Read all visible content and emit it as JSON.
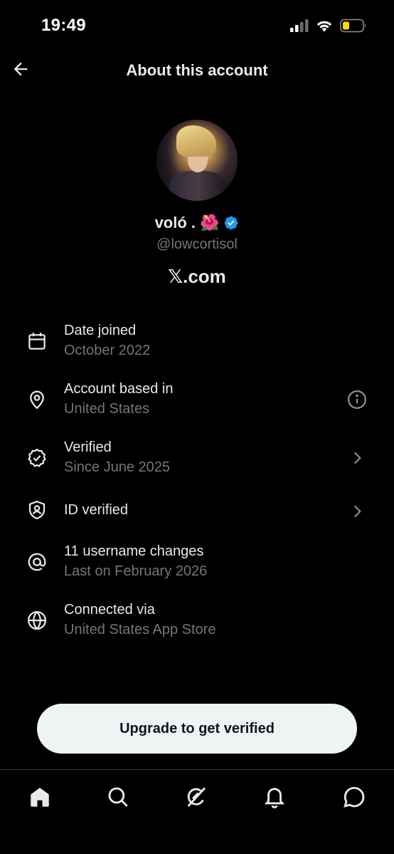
{
  "status_bar": {
    "time": "19:49",
    "icons": [
      "cellular-signal-icon",
      "wifi-icon",
      "battery-low-icon"
    ]
  },
  "header": {
    "title": "About this account",
    "back_icon": "arrow-left-icon"
  },
  "profile": {
    "display_name": "voló .",
    "emoji": "🌺",
    "verified_badge": "verified-badge-icon",
    "handle": "@lowcortisol",
    "platform": "𝕏.com"
  },
  "info": [
    {
      "icon": "calendar-icon",
      "title": "Date joined",
      "subtitle": "October 2022",
      "trailing": ""
    },
    {
      "icon": "location-pin-icon",
      "title": "Account based in",
      "subtitle": "United States",
      "trailing": "info-icon"
    },
    {
      "icon": "verified-check-icon",
      "title": "Verified",
      "subtitle": "Since June 2025",
      "trailing": "chevron-right-icon"
    },
    {
      "icon": "id-shield-icon",
      "title": "ID verified",
      "subtitle": "",
      "trailing": "chevron-right-icon"
    },
    {
      "icon": "at-sign-icon",
      "title": "11 username changes",
      "subtitle": "Last on February 2026",
      "trailing": ""
    },
    {
      "icon": "globe-icon",
      "title": "Connected via",
      "subtitle": "United States App Store",
      "trailing": ""
    }
  ],
  "upgrade_button": "Upgrade to get verified",
  "tab_bar": [
    "home-icon",
    "search-icon",
    "grok-icon",
    "notifications-bell-icon",
    "messages-icon"
  ],
  "colors": {
    "background": "#000000",
    "primary_text": "#e7e9ea",
    "secondary_text": "#71767b",
    "verified_blue": "#1d9bf0",
    "button_bg": "#eff3f4",
    "battery_yellow": "#ffd60a"
  }
}
